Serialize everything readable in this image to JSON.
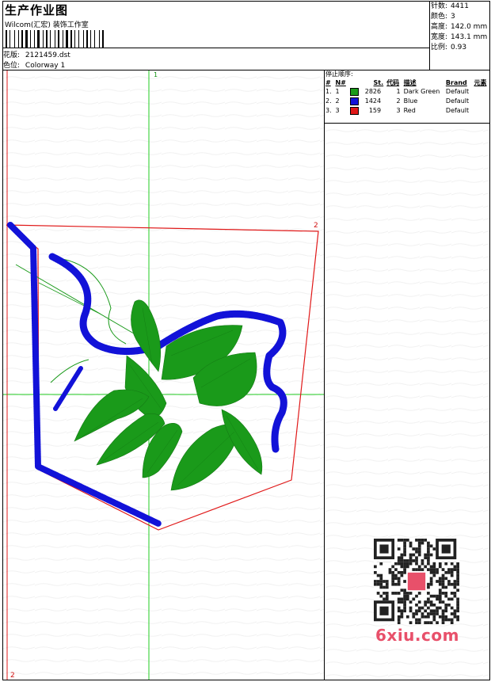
{
  "header": {
    "title": "生产作业图",
    "company": "Wilcom(汇宏) 装饰工作室",
    "design_label": "花版:",
    "design_value": "2121459.dst",
    "colorway_label": "色位:",
    "colorway_value": "Colorway 1"
  },
  "specs": [
    {
      "label": "针数:",
      "value": "4411"
    },
    {
      "label": "颜色:",
      "value": "3"
    },
    {
      "label": "高度:",
      "value": "142.0 mm"
    },
    {
      "label": "宽度:",
      "value": "143.1 mm"
    },
    {
      "label": "比例:",
      "value": "0.93"
    }
  ],
  "stop_sequence": {
    "title": "停止顺序:",
    "columns": [
      "#",
      "N#",
      "St.",
      "代码",
      "描述",
      "Brand",
      "元素"
    ],
    "rows": [
      {
        "num": "1.",
        "n": "1",
        "color": "#1a9a1a",
        "stitches": "2826",
        "code": "1",
        "desc": "Dark Green",
        "brand": "Default",
        "element": ""
      },
      {
        "num": "2.",
        "n": "2",
        "color": "#1212d8",
        "stitches": "1424",
        "code": "2",
        "desc": "Blue",
        "brand": "Default",
        "element": ""
      },
      {
        "num": "3.",
        "n": "3",
        "color": "#e01818",
        "stitches": "159",
        "code": "3",
        "desc": "Red",
        "brand": "Default",
        "element": ""
      }
    ]
  },
  "markers": {
    "top_green": "1",
    "right_red": "2",
    "bottom_red": "2"
  },
  "colors": {
    "green": "#1a9a1a",
    "blue": "#1212d8",
    "red": "#e01818",
    "axis": "#22cc22",
    "logo": "#e8506a"
  },
  "watermark": {
    "logo_text": "6xiu.com"
  }
}
